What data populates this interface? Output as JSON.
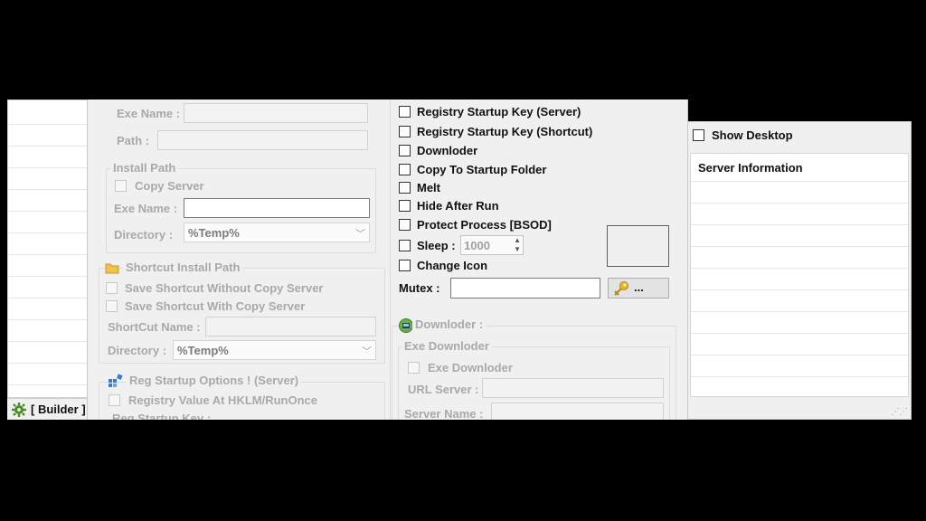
{
  "builder": {
    "name_label": "Exe Name :",
    "path_label": "Path :",
    "install_path": {
      "title": "Install Path",
      "copy_server": "Copy Server",
      "exe_name_label": "Exe Name :",
      "directory_label": "Directory :",
      "directory_value": "%Temp%"
    },
    "shortcut": {
      "title": "Shortcut Install Path",
      "save_without_copy": "Save Shortcut Without Copy Server",
      "save_with_copy": "Save Shortcut With Copy Server",
      "name_label": "ShortCut Name :",
      "directory_label": "Directory :",
      "directory_value": "%Temp%"
    },
    "reg_startup": {
      "title": "Reg Startup Options ! (Server)",
      "hklm_runonce": "Registry Value At HKLM/RunOnce",
      "key_label": "Reg Startup Key :"
    },
    "options": [
      "Registry Startup Key (Server)",
      "Registry Startup Key (Shortcut)",
      "Downloder",
      "Copy To Startup Folder",
      "Melt",
      "Hide After Run",
      "Protect Process [BSOD]"
    ],
    "sleep_label": "Sleep :",
    "sleep_value": "1000",
    "change_icon": "Change Icon",
    "mutex_label": "Mutex :",
    "mutex_button": "...",
    "downloader": {
      "title": "Downloder :",
      "exe_group_title": "Exe Downloder",
      "exe_checkbox": "Exe Downloder",
      "url_label": "URL Server :",
      "server_name_label": "Server Name :"
    }
  },
  "right_panel": {
    "show_desktop": "Show Desktop",
    "column_header": "Server Information"
  },
  "tab": {
    "label": "[ Builder ]"
  }
}
